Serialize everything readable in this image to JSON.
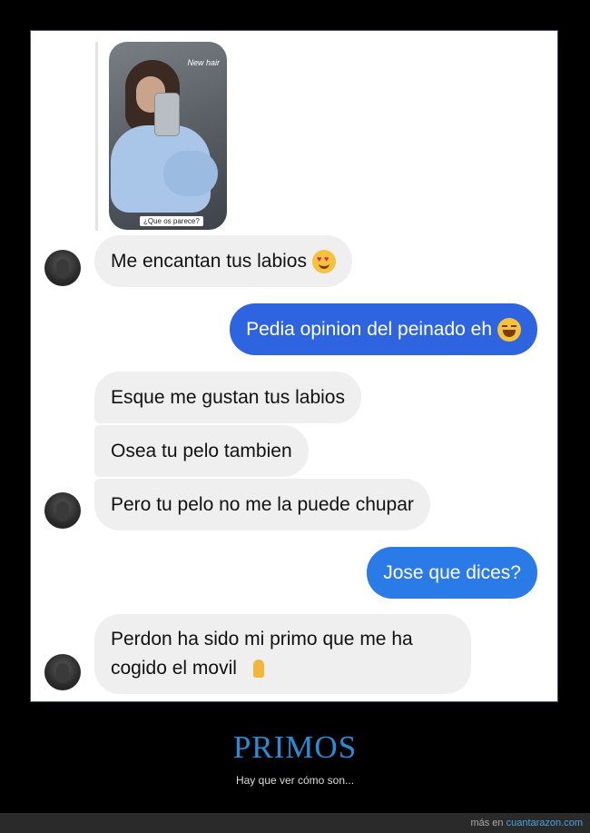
{
  "story": {
    "overlay_text": "New hair",
    "caption": "¿Que os parece?"
  },
  "messages": [
    {
      "from": "them",
      "text": "Me encantan tus labios"
    },
    {
      "from": "me",
      "text": "Pedia opinion del peinado eh"
    },
    {
      "from": "them",
      "text": "Esque me gustan tus labios"
    },
    {
      "from": "them",
      "text": "Osea tu pelo tambien"
    },
    {
      "from": "them",
      "text": "Pero tu pelo no me la puede chupar"
    },
    {
      "from": "me",
      "text": "Jose que dices?"
    },
    {
      "from": "them",
      "text": "Perdon ha sido mi primo que me ha cogido el movil"
    }
  ],
  "post": {
    "title": "PRIMOS",
    "subtitle": "Hay que ver cómo son..."
  },
  "footer": {
    "prefix": "más en",
    "site": "cuantarazon.com"
  },
  "colors": {
    "sent_bubble": "#2f64e0",
    "received_bubble": "#efefef",
    "title": "#2a8bd6"
  }
}
